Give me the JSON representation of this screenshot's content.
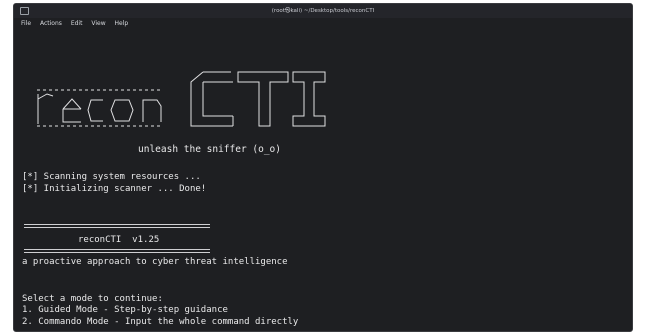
{
  "window": {
    "title": "(root\u0000kali)-[/home/kali/Desktop/tools/reconCTI]",
    "title_display": "(root㉿kali) ~/Desktop/tools/reconCTI",
    "accent": "#1e1f22"
  },
  "menu": [
    "File",
    "Actions",
    "Edit",
    "View",
    "Help"
  ],
  "banner": {
    "logo_text": "reconCTI",
    "tagline": "unleash the sniffer (o_o)"
  },
  "status": [
    "[*] Scanning system resources ...",
    "[*] Initializing scanner ... Done!"
  ],
  "version_box": "reconCTI  v1.25",
  "description": "a proactive approach to cyber threat intelligence",
  "mode_prompt": "Select a mode to continue:",
  "modes": [
    "1. Guided Mode - Step-by-step guidance",
    "2. Commando Mode - Input the whole command directly"
  ]
}
